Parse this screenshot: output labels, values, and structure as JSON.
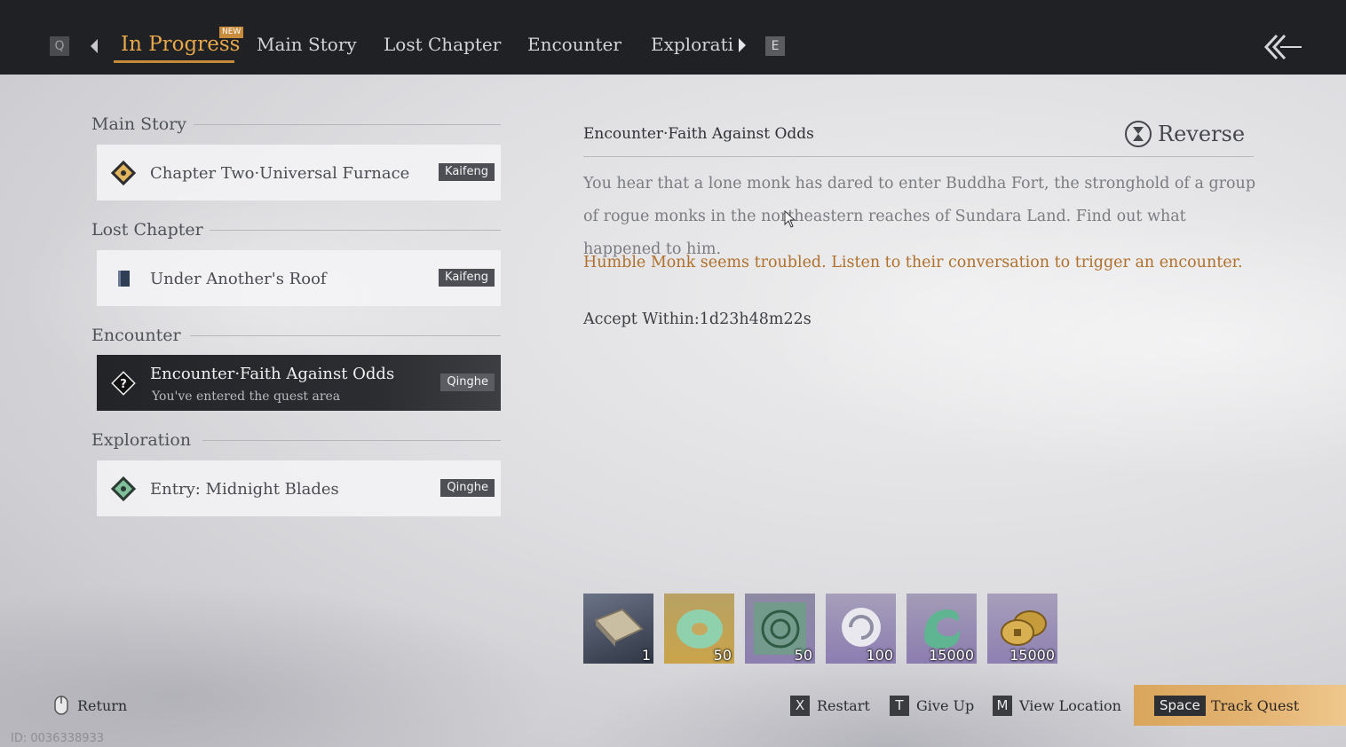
{
  "topbar": {
    "left_key": "Q",
    "right_key": "E",
    "new_badge": "NEW",
    "tabs": [
      {
        "label": "In Progress",
        "active": true
      },
      {
        "label": "Main Story",
        "active": false
      },
      {
        "label": "Lost Chapter",
        "active": false
      },
      {
        "label": "Encounter",
        "active": false
      },
      {
        "label": "Explorati",
        "active": false
      }
    ]
  },
  "quest_list": {
    "sections": [
      {
        "heading": "Main Story",
        "item": {
          "title": "Chapter Two·Universal Furnace",
          "subtitle": "",
          "location": "Kaifeng",
          "icon": "main-story-icon"
        }
      },
      {
        "heading": "Lost Chapter",
        "item": {
          "title": "Under Another's Roof",
          "subtitle": "",
          "location": "Kaifeng",
          "icon": "book-icon"
        }
      },
      {
        "heading": "Encounter",
        "item": {
          "title": "Encounter·Faith Against Odds",
          "subtitle": "You've entered the quest area",
          "location": "Qinghe",
          "icon": "question-diamond-icon",
          "selected": true
        }
      },
      {
        "heading": "Exploration",
        "item": {
          "title": "Entry: Midnight Blades",
          "subtitle": "",
          "location": "Qinghe",
          "icon": "exploration-icon"
        }
      }
    ]
  },
  "detail": {
    "title": "Encounter·Faith Against Odds",
    "reverse_label": "Reverse",
    "description": "You hear that a lone monk has dared to enter Buddha Fort, the stronghold of a group of rogue monks in the northeastern reaches of Sundara Land. Find out what happened to him.",
    "hint": "Humble Monk seems troubled. Listen to their conversation to trigger an encounter.",
    "accept_within": "Accept Within:1d23h48m22s"
  },
  "rewards": [
    {
      "name": "book-reward-icon",
      "count": "1"
    },
    {
      "name": "jade-ring-reward-icon",
      "count": "50"
    },
    {
      "name": "jade-disc-reward-icon",
      "count": "50"
    },
    {
      "name": "swirl-reward-icon",
      "count": "100"
    },
    {
      "name": "green-swirl-reward-icon",
      "count": "15000"
    },
    {
      "name": "coins-reward-icon",
      "count": "15000"
    }
  ],
  "footer": {
    "return_label": "Return",
    "restart_key": "X",
    "restart_label": "Restart",
    "giveup_key": "T",
    "giveup_label": "Give Up",
    "location_key": "M",
    "location_label": "View Location",
    "track_key": "Space",
    "track_label": "Track Quest",
    "id_text": "ID: 0036338933"
  },
  "colors": {
    "accent": "#e7a74b",
    "hint": "#b0702c",
    "topbar": "#1f2124"
  }
}
